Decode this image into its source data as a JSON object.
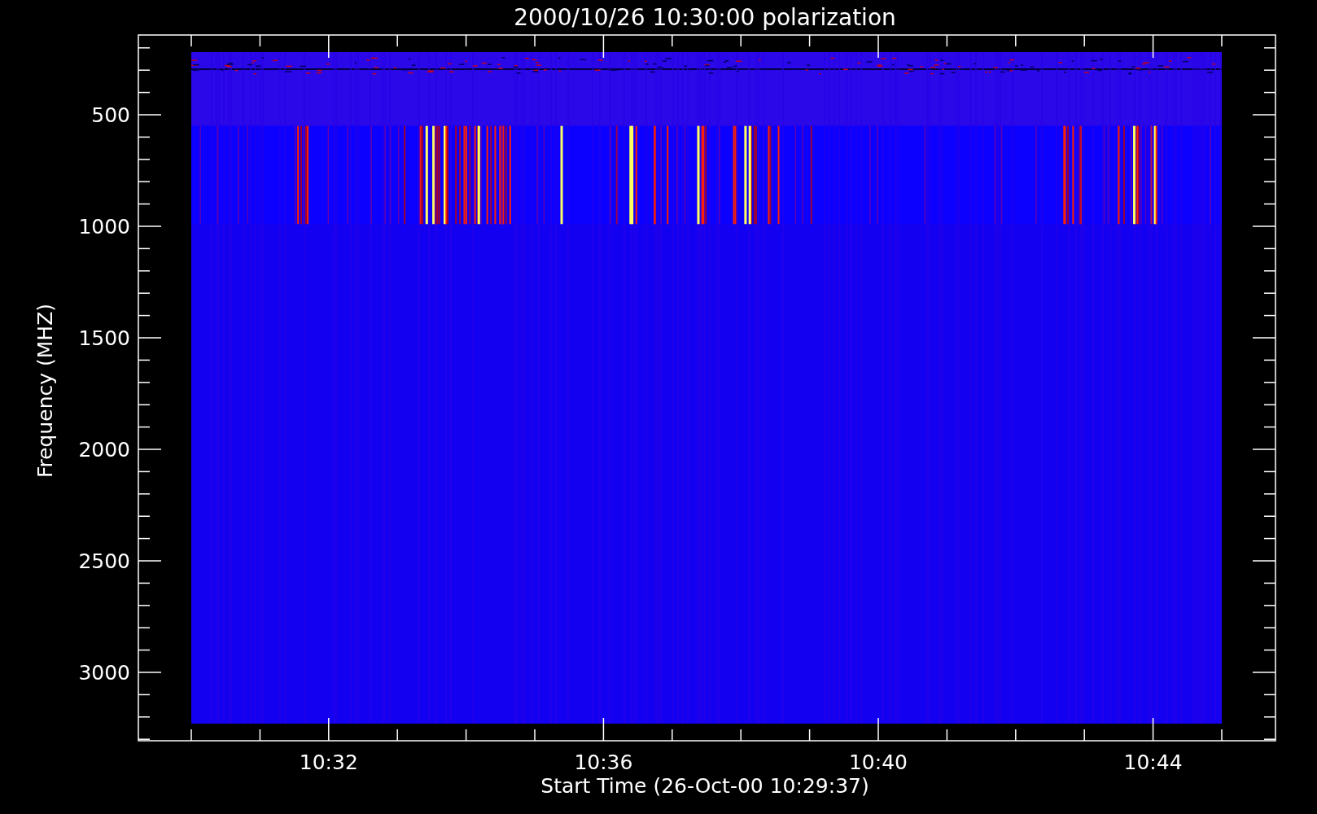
{
  "plot": {
    "title": "2000/10/26 10:30:00 polarization",
    "ylabel": "Frequency (MHZ)",
    "xlabel": "Start Time (26-Oct-00 10:29:37)",
    "yticks": [
      "500",
      "1000",
      "1500",
      "2000",
      "2500",
      "3000"
    ],
    "xticks": [
      "10:32",
      "10:36",
      "10:40",
      "10:44"
    ]
  }
}
